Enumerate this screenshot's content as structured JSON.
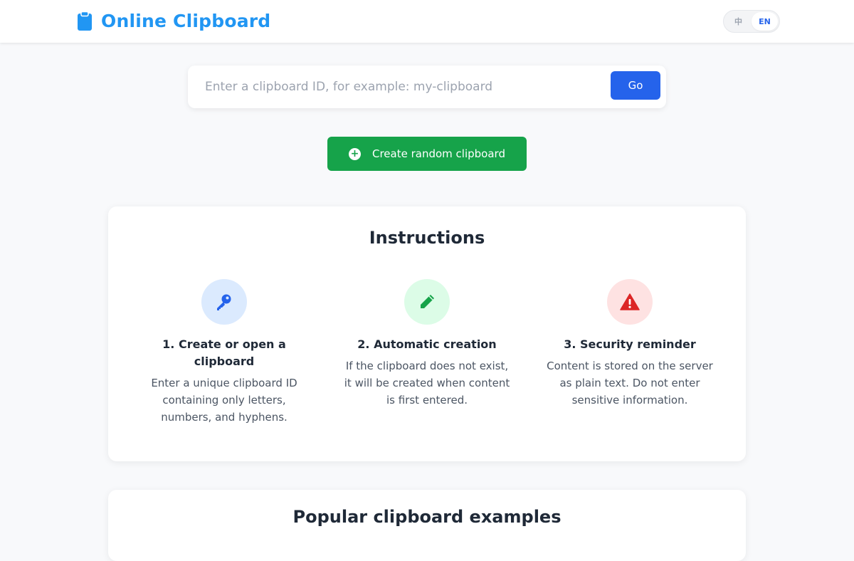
{
  "header": {
    "title": "Online Clipboard",
    "lang_options": [
      "中",
      "EN"
    ],
    "active_lang": "EN"
  },
  "search": {
    "placeholder": "Enter a clipboard ID, for example: my-clipboard",
    "go_label": "Go"
  },
  "random_button": {
    "label": "Create random clipboard"
  },
  "instructions": {
    "title": "Instructions",
    "steps": [
      {
        "title": "1. Create or open a clipboard",
        "description": "Enter a unique clipboard ID containing only letters, numbers, and hyphens.",
        "icon": "key-icon",
        "color": "#2563eb",
        "bg": "#dbeafe"
      },
      {
        "title": "2. Automatic creation",
        "description": "If the clipboard does not exist, it will be created when content is first entered.",
        "icon": "pencil-icon",
        "color": "#16a34a",
        "bg": "#dcfce7"
      },
      {
        "title": "3. Security reminder",
        "description": "Content is stored on the server as plain text. Do not enter sensitive information.",
        "icon": "warning-icon",
        "color": "#dc2626",
        "bg": "#fee2e2"
      }
    ]
  },
  "popular": {
    "title": "Popular clipboard examples"
  },
  "colors": {
    "brand": "#2196f3",
    "primary": "#2563eb",
    "success": "#16a34a"
  }
}
